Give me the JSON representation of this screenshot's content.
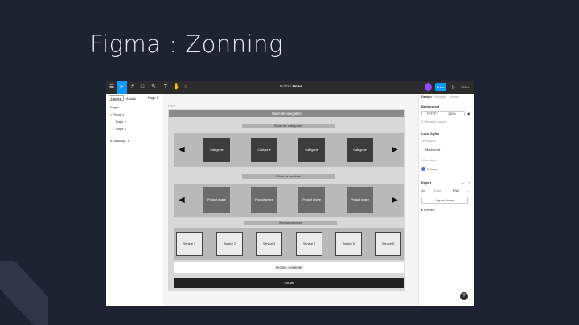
{
  "slide": {
    "title": "Figma : Zonning"
  },
  "toolbar": {
    "title_prefix": "Drafts",
    "title_file": "Home",
    "share_label": "Share",
    "zoom": "100%"
  },
  "left_panel": {
    "tab_layers": "Layers",
    "tab_assets": "Assets",
    "page_tab": "Page 1",
    "section_pages": "Pages",
    "pages": [
      "Page 1",
      "Page 2",
      "Page 3"
    ],
    "frame_item": "Desktop - 1"
  },
  "right_panel": {
    "tabs": [
      "Design",
      "Prototype",
      "Inspect"
    ],
    "frame_heading": "Background",
    "hex_value": "FFFFFF",
    "opacity_value": "100%",
    "show_in_exports": "Show in exports",
    "local_styles": "Local Styles",
    "text_styles": "Text styles",
    "text_style_name": "Montserrat",
    "color_styles": "Color styles",
    "color_style_name": "Primary",
    "export_heading": "Export",
    "export_scale": "1x",
    "export_suffix": "Suffix",
    "export_format": "PNG",
    "export_button": "Export Home",
    "preview": "Preview"
  },
  "canvas": {
    "frame_label": "Home",
    "top_banner": "Barre de navigation",
    "section_categories": "Slider de catégories",
    "categories": [
      "Catégorie",
      "Catégorie",
      "Catégorie",
      "Catégorie"
    ],
    "section_products": "Slider de produits",
    "products": [
      "Produit phare",
      "Produit phare",
      "Produit phare",
      "Produit phare"
    ],
    "section_services": "Section services",
    "services": [
      "Service 1",
      "Service 2",
      "Service 3",
      "Service 4",
      "Service 5",
      "Service 6"
    ],
    "white_bar": "Section newsletter",
    "footer": "Footer"
  },
  "colors": {
    "accent": "#0d99ff",
    "avatar": "#9747ff",
    "bg": "#1d2331"
  },
  "help_label": "?"
}
